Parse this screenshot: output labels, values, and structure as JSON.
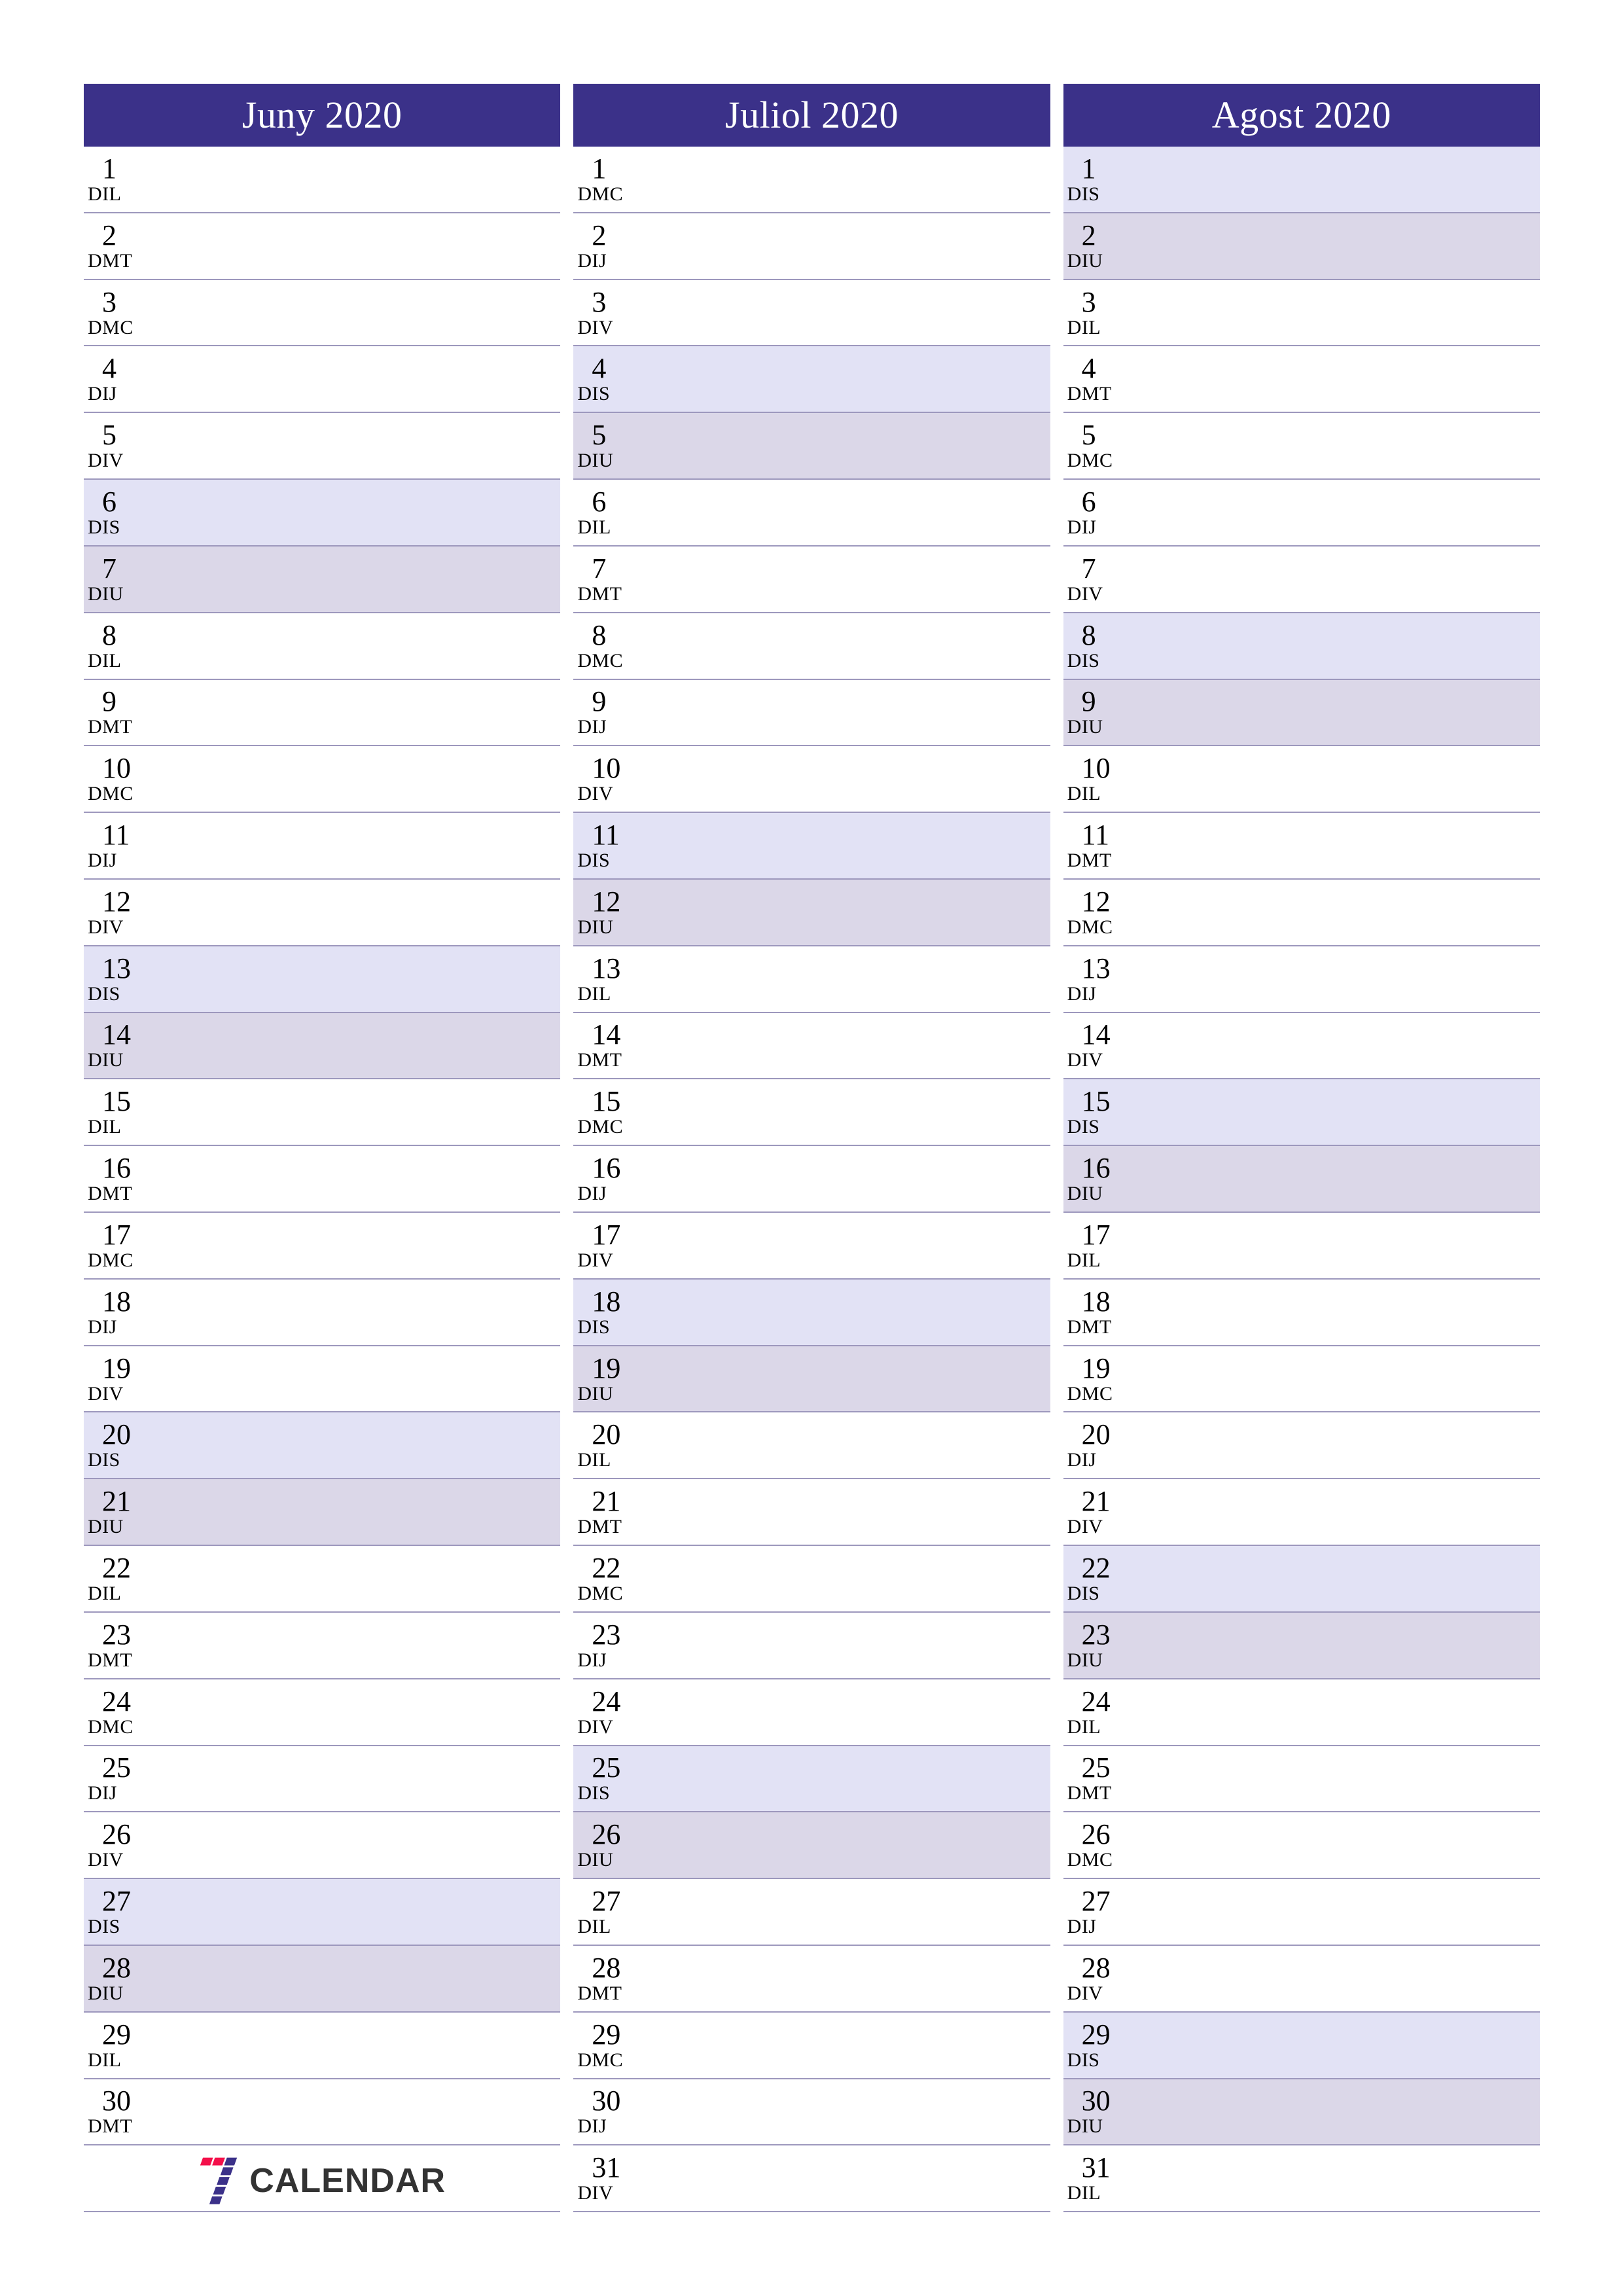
{
  "document": {
    "kind": "printable-calendar",
    "orientation": "portrait",
    "columns": 3
  },
  "colors": {
    "header_bg": "#3b3189",
    "header_text": "#ffffff",
    "saturday_bg": "#e2e2f5",
    "sunday_bg": "#dbd7e8",
    "rule": "#9d98bd",
    "day_text": "#000000",
    "logo_red": "#f4104a",
    "logo_purple": "#3b3189",
    "logo_word": "#333333"
  },
  "logo": {
    "mark_name": "seven-calendar-logo",
    "text": "CALENDAR"
  },
  "months": [
    {
      "title": "Juny 2020",
      "name": "Juny",
      "year": "2020",
      "days": [
        {
          "num": "1",
          "abbr": "DIL",
          "type": "weekday"
        },
        {
          "num": "2",
          "abbr": "DMT",
          "type": "weekday"
        },
        {
          "num": "3",
          "abbr": "DMC",
          "type": "weekday"
        },
        {
          "num": "4",
          "abbr": "DIJ",
          "type": "weekday"
        },
        {
          "num": "5",
          "abbr": "DIV",
          "type": "weekday"
        },
        {
          "num": "6",
          "abbr": "DIS",
          "type": "saturday"
        },
        {
          "num": "7",
          "abbr": "DIU",
          "type": "sunday"
        },
        {
          "num": "8",
          "abbr": "DIL",
          "type": "weekday"
        },
        {
          "num": "9",
          "abbr": "DMT",
          "type": "weekday"
        },
        {
          "num": "10",
          "abbr": "DMC",
          "type": "weekday"
        },
        {
          "num": "11",
          "abbr": "DIJ",
          "type": "weekday"
        },
        {
          "num": "12",
          "abbr": "DIV",
          "type": "weekday"
        },
        {
          "num": "13",
          "abbr": "DIS",
          "type": "saturday"
        },
        {
          "num": "14",
          "abbr": "DIU",
          "type": "sunday"
        },
        {
          "num": "15",
          "abbr": "DIL",
          "type": "weekday"
        },
        {
          "num": "16",
          "abbr": "DMT",
          "type": "weekday"
        },
        {
          "num": "17",
          "abbr": "DMC",
          "type": "weekday"
        },
        {
          "num": "18",
          "abbr": "DIJ",
          "type": "weekday"
        },
        {
          "num": "19",
          "abbr": "DIV",
          "type": "weekday"
        },
        {
          "num": "20",
          "abbr": "DIS",
          "type": "saturday"
        },
        {
          "num": "21",
          "abbr": "DIU",
          "type": "sunday"
        },
        {
          "num": "22",
          "abbr": "DIL",
          "type": "weekday"
        },
        {
          "num": "23",
          "abbr": "DMT",
          "type": "weekday"
        },
        {
          "num": "24",
          "abbr": "DMC",
          "type": "weekday"
        },
        {
          "num": "25",
          "abbr": "DIJ",
          "type": "weekday"
        },
        {
          "num": "26",
          "abbr": "DIV",
          "type": "weekday"
        },
        {
          "num": "27",
          "abbr": "DIS",
          "type": "saturday"
        },
        {
          "num": "28",
          "abbr": "DIU",
          "type": "sunday"
        },
        {
          "num": "29",
          "abbr": "DIL",
          "type": "weekday"
        },
        {
          "num": "30",
          "abbr": "DMT",
          "type": "weekday"
        }
      ],
      "trailing_slot": "logo"
    },
    {
      "title": "Juliol 2020",
      "name": "Juliol",
      "year": "2020",
      "days": [
        {
          "num": "1",
          "abbr": "DMC",
          "type": "weekday"
        },
        {
          "num": "2",
          "abbr": "DIJ",
          "type": "weekday"
        },
        {
          "num": "3",
          "abbr": "DIV",
          "type": "weekday"
        },
        {
          "num": "4",
          "abbr": "DIS",
          "type": "saturday"
        },
        {
          "num": "5",
          "abbr": "DIU",
          "type": "sunday"
        },
        {
          "num": "6",
          "abbr": "DIL",
          "type": "weekday"
        },
        {
          "num": "7",
          "abbr": "DMT",
          "type": "weekday"
        },
        {
          "num": "8",
          "abbr": "DMC",
          "type": "weekday"
        },
        {
          "num": "9",
          "abbr": "DIJ",
          "type": "weekday"
        },
        {
          "num": "10",
          "abbr": "DIV",
          "type": "weekday"
        },
        {
          "num": "11",
          "abbr": "DIS",
          "type": "saturday"
        },
        {
          "num": "12",
          "abbr": "DIU",
          "type": "sunday"
        },
        {
          "num": "13",
          "abbr": "DIL",
          "type": "weekday"
        },
        {
          "num": "14",
          "abbr": "DMT",
          "type": "weekday"
        },
        {
          "num": "15",
          "abbr": "DMC",
          "type": "weekday"
        },
        {
          "num": "16",
          "abbr": "DIJ",
          "type": "weekday"
        },
        {
          "num": "17",
          "abbr": "DIV",
          "type": "weekday"
        },
        {
          "num": "18",
          "abbr": "DIS",
          "type": "saturday"
        },
        {
          "num": "19",
          "abbr": "DIU",
          "type": "sunday"
        },
        {
          "num": "20",
          "abbr": "DIL",
          "type": "weekday"
        },
        {
          "num": "21",
          "abbr": "DMT",
          "type": "weekday"
        },
        {
          "num": "22",
          "abbr": "DMC",
          "type": "weekday"
        },
        {
          "num": "23",
          "abbr": "DIJ",
          "type": "weekday"
        },
        {
          "num": "24",
          "abbr": "DIV",
          "type": "weekday"
        },
        {
          "num": "25",
          "abbr": "DIS",
          "type": "saturday"
        },
        {
          "num": "26",
          "abbr": "DIU",
          "type": "sunday"
        },
        {
          "num": "27",
          "abbr": "DIL",
          "type": "weekday"
        },
        {
          "num": "28",
          "abbr": "DMT",
          "type": "weekday"
        },
        {
          "num": "29",
          "abbr": "DMC",
          "type": "weekday"
        },
        {
          "num": "30",
          "abbr": "DIJ",
          "type": "weekday"
        },
        {
          "num": "31",
          "abbr": "DIV",
          "type": "weekday"
        }
      ],
      "trailing_slot": "none"
    },
    {
      "title": "Agost 2020",
      "name": "Agost",
      "year": "2020",
      "days": [
        {
          "num": "1",
          "abbr": "DIS",
          "type": "saturday"
        },
        {
          "num": "2",
          "abbr": "DIU",
          "type": "sunday"
        },
        {
          "num": "3",
          "abbr": "DIL",
          "type": "weekday"
        },
        {
          "num": "4",
          "abbr": "DMT",
          "type": "weekday"
        },
        {
          "num": "5",
          "abbr": "DMC",
          "type": "weekday"
        },
        {
          "num": "6",
          "abbr": "DIJ",
          "type": "weekday"
        },
        {
          "num": "7",
          "abbr": "DIV",
          "type": "weekday"
        },
        {
          "num": "8",
          "abbr": "DIS",
          "type": "saturday"
        },
        {
          "num": "9",
          "abbr": "DIU",
          "type": "sunday"
        },
        {
          "num": "10",
          "abbr": "DIL",
          "type": "weekday"
        },
        {
          "num": "11",
          "abbr": "DMT",
          "type": "weekday"
        },
        {
          "num": "12",
          "abbr": "DMC",
          "type": "weekday"
        },
        {
          "num": "13",
          "abbr": "DIJ",
          "type": "weekday"
        },
        {
          "num": "14",
          "abbr": "DIV",
          "type": "weekday"
        },
        {
          "num": "15",
          "abbr": "DIS",
          "type": "saturday"
        },
        {
          "num": "16",
          "abbr": "DIU",
          "type": "sunday"
        },
        {
          "num": "17",
          "abbr": "DIL",
          "type": "weekday"
        },
        {
          "num": "18",
          "abbr": "DMT",
          "type": "weekday"
        },
        {
          "num": "19",
          "abbr": "DMC",
          "type": "weekday"
        },
        {
          "num": "20",
          "abbr": "DIJ",
          "type": "weekday"
        },
        {
          "num": "21",
          "abbr": "DIV",
          "type": "weekday"
        },
        {
          "num": "22",
          "abbr": "DIS",
          "type": "saturday"
        },
        {
          "num": "23",
          "abbr": "DIU",
          "type": "sunday"
        },
        {
          "num": "24",
          "abbr": "DIL",
          "type": "weekday"
        },
        {
          "num": "25",
          "abbr": "DMT",
          "type": "weekday"
        },
        {
          "num": "26",
          "abbr": "DMC",
          "type": "weekday"
        },
        {
          "num": "27",
          "abbr": "DIJ",
          "type": "weekday"
        },
        {
          "num": "28",
          "abbr": "DIV",
          "type": "weekday"
        },
        {
          "num": "29",
          "abbr": "DIS",
          "type": "saturday"
        },
        {
          "num": "30",
          "abbr": "DIU",
          "type": "sunday"
        },
        {
          "num": "31",
          "abbr": "DIL",
          "type": "weekday"
        }
      ],
      "trailing_slot": "none"
    }
  ]
}
